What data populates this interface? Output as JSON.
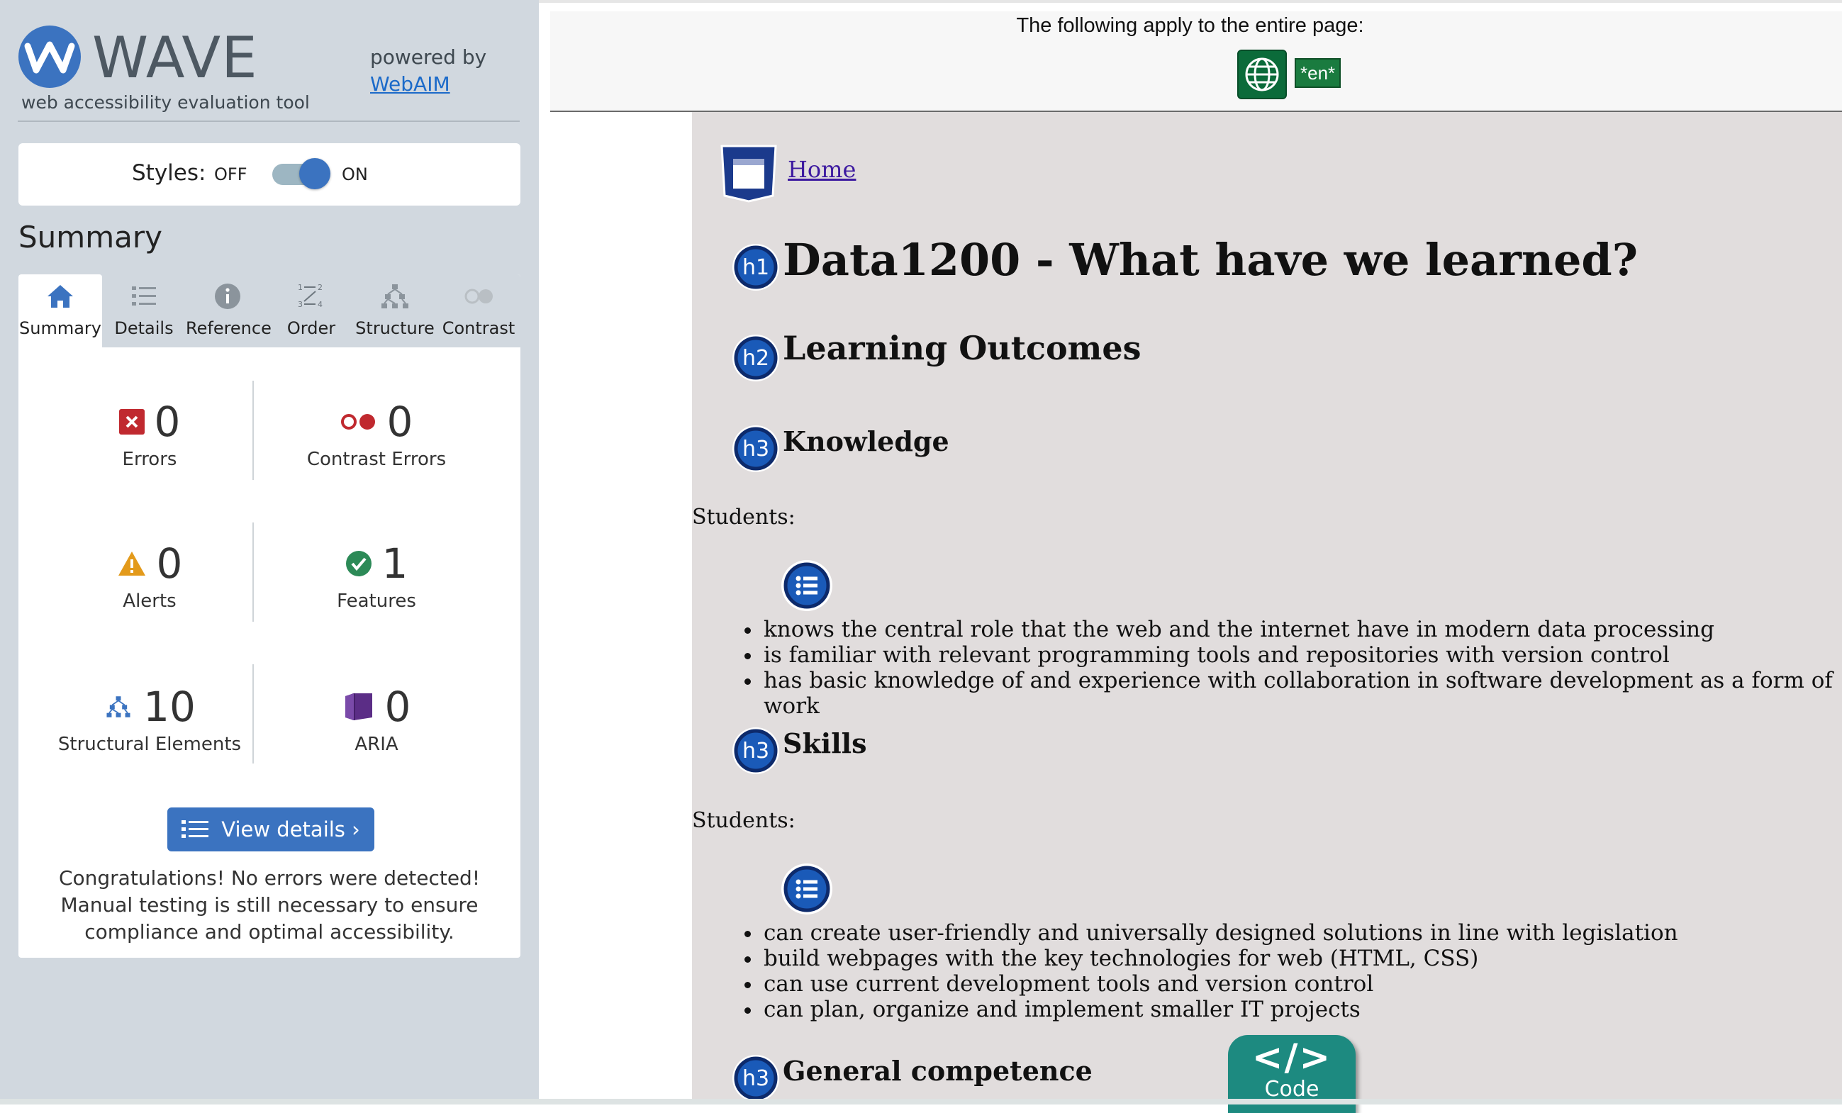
{
  "brand": {
    "name": "WAVE",
    "tagline": "web accessibility evaluation tool",
    "powered_by": "powered by",
    "webaim_link": "WebAIM"
  },
  "styles_toggle": {
    "label": "Styles:",
    "off": "OFF",
    "on": "ON",
    "state": "on"
  },
  "summary_heading": "Summary",
  "tabs": [
    {
      "label": "Summary",
      "icon": "home-icon",
      "active": true
    },
    {
      "label": "Details",
      "icon": "list-icon",
      "active": false
    },
    {
      "label": "Reference",
      "icon": "info-icon",
      "active": false
    },
    {
      "label": "Order",
      "icon": "order-icon",
      "active": false
    },
    {
      "label": "Structure",
      "icon": "structure-icon",
      "active": false
    },
    {
      "label": "Contrast",
      "icon": "contrast-icon",
      "active": false
    }
  ],
  "stats": {
    "errors": {
      "count": "0",
      "label": "Errors",
      "icon": "error-icon",
      "color": "#c0292f"
    },
    "contrast_errors": {
      "count": "0",
      "label": "Contrast Errors",
      "icon": "contrast-error-icon",
      "color": "#c0292f"
    },
    "alerts": {
      "count": "0",
      "label": "Alerts",
      "icon": "alert-icon",
      "color": "#e39a1b"
    },
    "features": {
      "count": "1",
      "label": "Features",
      "icon": "feature-check-icon",
      "color": "#2c8a57"
    },
    "structural": {
      "count": "10",
      "label": "Structural Elements",
      "icon": "structure-icon",
      "color": "#3b73c0"
    },
    "aria": {
      "count": "0",
      "label": "ARIA",
      "icon": "aria-cube-icon",
      "color": "#5b2d86"
    }
  },
  "view_details_label": "View details ›",
  "congrats_text": "Congratulations! No errors were detected! Manual testing is still necessary to ensure compliance and optimal accessibility.",
  "page": {
    "banner_text": "The following apply to the entire page:",
    "lang_tag": "*en*",
    "home_link": "Home",
    "h1": "Data1200 - What have we learned?",
    "h2": "Learning Outcomes",
    "h3_knowledge": "Knowledge",
    "students_label_1": "Students:",
    "knowledge_items": [
      "knows the central role that the web and the internet have in modern data processing",
      "is familiar with relevant programming tools and repositories with version control",
      "has basic knowledge of and experience with collaboration in software development as a form of work"
    ],
    "h3_skills": "Skills",
    "students_label_2": "Students:",
    "skills_items": [
      "can create user-friendly and universally designed solutions in line with legislation",
      "build webpages with the key technologies for web (HTML, CSS)",
      "can use current development tools and version control",
      "can plan, organize and implement smaller IT projects"
    ],
    "h3_general": "General competence",
    "heading_badges": {
      "h1": "h1",
      "h2": "h2",
      "h3": "h3"
    },
    "code_button": {
      "glyph": "</>",
      "label": "Code"
    }
  },
  "colors": {
    "wave_blue": "#3b73c0",
    "sidebar_bg": "#d1d8df",
    "page_bg": "#e1dddd",
    "badge_navy": "#0d2a6b"
  }
}
